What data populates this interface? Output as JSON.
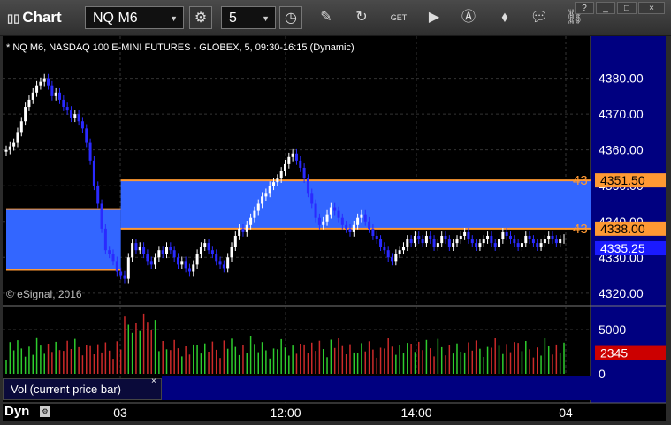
{
  "window": {
    "title": "Chart"
  },
  "toolbar": {
    "symbol": "NQ M6",
    "interval": "5",
    "tools": [
      "settings-icon",
      "clock-icon",
      "pencil-icon",
      "refresh-icon",
      "get-icon",
      "play-icon",
      "alert-icon",
      "eraser-icon",
      "chat-icon"
    ]
  },
  "window_buttons": [
    "?",
    "_",
    "□",
    "×"
  ],
  "chart": {
    "header": "* NQ M6, NASDAQ 100 E-MINI FUTURES - GLOBEX, 5, 09:30-16:15 (Dynamic)",
    "copyright": "© eSignal, 2016",
    "price_labels": {
      "upper": "4351.50",
      "lower": "4338.00",
      "last": "4335.25",
      "left_cut_upper": "43",
      "left_cut_lower": "43"
    },
    "volume": {
      "label": "Vol (current price bar)",
      "value": "2345",
      "close_glyph": "×"
    },
    "footer": {
      "mode": "Dyn",
      "x_ticks": [
        "03",
        "12:00",
        "14:00",
        "04"
      ]
    }
  },
  "colors": {
    "up": "#ffffff",
    "down": "#2a2aff",
    "zone": "#3366ff",
    "zone_border": "#ff9933",
    "last": "#1a1aff",
    "vol_up": "#2ecc2e",
    "vol_down": "#cc2a2a"
  },
  "chart_data": [
    {
      "type": "candlestick",
      "y_ticks": [
        "4380.00",
        "4370.00",
        "4360.00",
        "4350.00",
        "4340.00",
        "4330.00",
        "4320.00"
      ],
      "ylim": [
        4317,
        4391
      ],
      "zones": [
        {
          "from": 4326.5,
          "to": 4343.5,
          "x_range": [
            0,
            30
          ]
        },
        {
          "from": 4338.0,
          "to": 4351.5,
          "x_range": [
            30,
            147
          ]
        }
      ],
      "last_price": 4335.25,
      "closes": [
        4360,
        4361,
        4362,
        4365,
        4368,
        4372,
        4374,
        4376,
        4378,
        4379,
        4380,
        4378,
        4375,
        4376,
        4374,
        4372,
        4371,
        4369,
        4370,
        4368,
        4366,
        4362,
        4357,
        4350,
        4345,
        4338,
        4332,
        4331,
        4329,
        4326,
        4325,
        4324,
        4330,
        4334,
        4332,
        4333,
        4331,
        4329,
        4328,
        4330,
        4332,
        4331,
        4333,
        4332,
        4330,
        4328,
        4329,
        4327,
        4326,
        4328,
        4331,
        4333,
        4334,
        4332,
        4331,
        4329,
        4328,
        4327,
        4330,
        4333,
        4336,
        4338,
        4337,
        4339,
        4341,
        4343,
        4345,
        4347,
        4348,
        4350,
        4351,
        4352,
        4354,
        4356,
        4358,
        4359,
        4357,
        4355,
        4352,
        4348,
        4345,
        4341,
        4339,
        4340,
        4342,
        4344,
        4343,
        4341,
        4339,
        4338,
        4337,
        4339,
        4341,
        4342,
        4340,
        4338,
        4336,
        4335,
        4333,
        4332,
        4330,
        4329,
        4331,
        4332,
        4333,
        4335,
        4334,
        4336,
        4335,
        4334,
        4336,
        4335,
        4333,
        4334,
        4336,
        4335,
        4333,
        4334,
        4335,
        4336,
        4337,
        4335,
        4334,
        4333,
        4334,
        4335,
        4336,
        4334,
        4333,
        4335,
        4337,
        4336,
        4335,
        4334,
        4333,
        4334,
        4336,
        4335,
        4334,
        4333,
        4334,
        4335,
        4336,
        4335,
        4334,
        4335,
        4335.25
      ]
    },
    {
      "type": "bar",
      "title": "Vol (current price bar)",
      "ylim": [
        0,
        7000
      ],
      "y_ticks": [
        "5000",
        "0"
      ],
      "last_value": 2345
    }
  ]
}
